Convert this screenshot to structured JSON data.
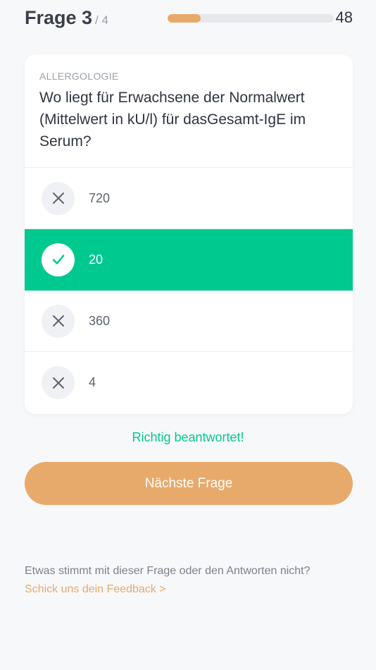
{
  "header": {
    "question_label": "Frage 3",
    "question_total": "/ 4",
    "progress": 0.2,
    "timer": "48"
  },
  "card": {
    "category": "ALLERGOLOGIE",
    "question": "Wo liegt für Erwachsene der Normalwert (Mittelwert in kU/l) für dasGesamt-IgE im Serum?",
    "answers": [
      {
        "label": "720",
        "state": "wrong",
        "icon": "x-icon"
      },
      {
        "label": "20",
        "state": "correct-selected",
        "icon": "check-icon"
      },
      {
        "label": "360",
        "state": "wrong",
        "icon": "x-icon"
      },
      {
        "label": "4",
        "state": "wrong",
        "icon": "x-icon"
      }
    ]
  },
  "feedback": "Richtig beantwortet!",
  "next_button": "Nächste Frage",
  "footer": {
    "text": "Etwas stimmt mit dieser Frage oder den Antworten nicht?",
    "link": "Schick uns dein Feedback >"
  },
  "colors": {
    "accent": "#e8aa6b",
    "correct": "#00c98f",
    "background": "#f7f8fa"
  }
}
